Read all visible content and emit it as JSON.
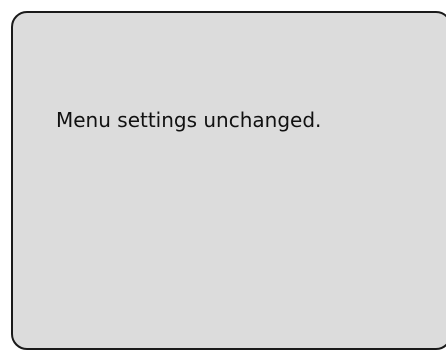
{
  "dialog": {
    "message": "Menu settings unchanged."
  }
}
